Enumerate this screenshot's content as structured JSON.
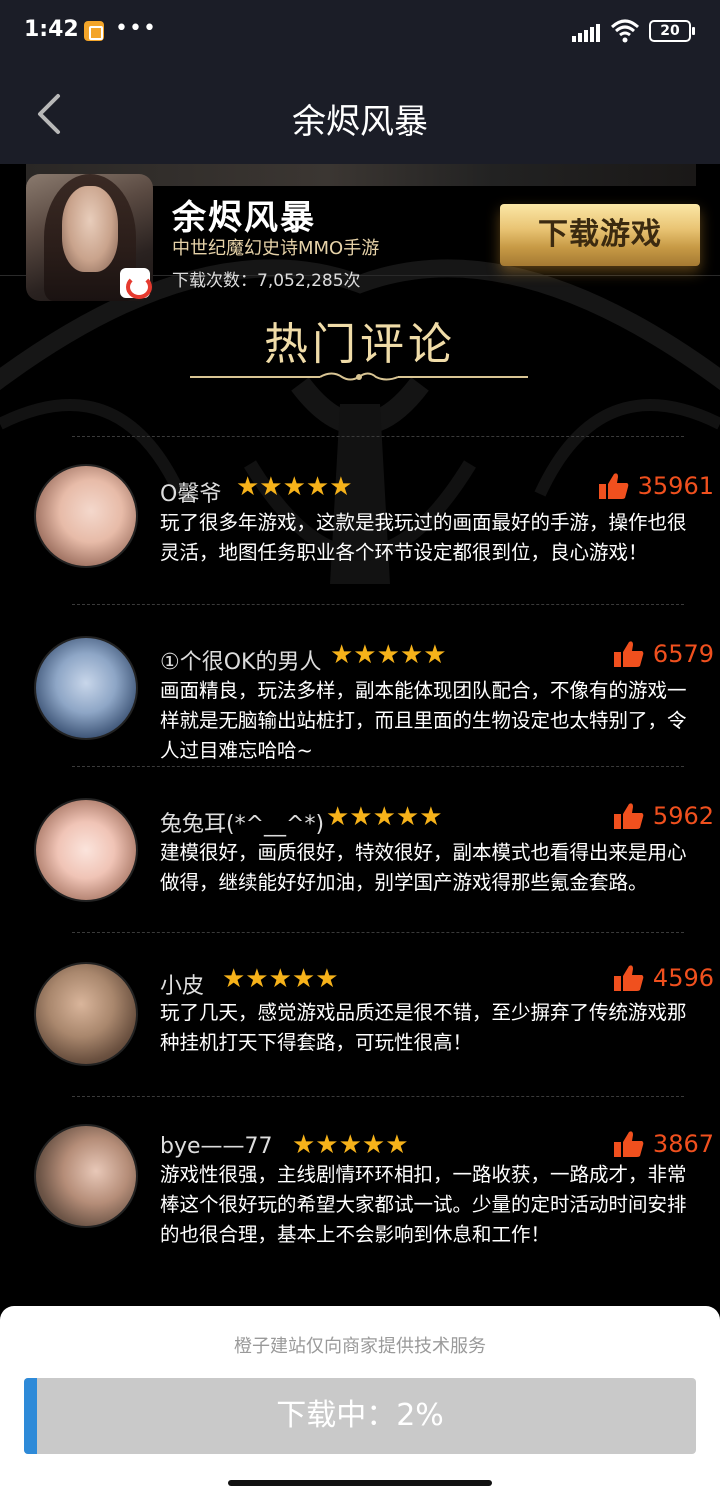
{
  "status_bar": {
    "time": "1:42",
    "dots": "•••",
    "battery": "20"
  },
  "nav": {
    "title": "余烬风暴"
  },
  "game": {
    "name": "余烬风暴",
    "subtitle": "中世纪魔幻史诗MMO手游",
    "downloads": "下载次数：7,052,285次",
    "download_button": "下载游戏"
  },
  "section": {
    "title": "热门评论"
  },
  "comments": [
    {
      "username": "O馨爷",
      "rating": 5,
      "stars": "★★★★★",
      "likes": "35961",
      "text": "玩了很多年游戏，这款是我玩过的画面最好的手游，操作也很灵活，地图任务职业各个环节设定都很到位，良心游戏！"
    },
    {
      "username": "①个很OK的男人",
      "rating": 5,
      "stars": "★★★★★",
      "likes": "6579",
      "text": "画面精良，玩法多样，副本能体现团队配合，不像有的游戏一样就是无脑输出站桩打，而且里面的生物设定也太特别了，令人过目难忘哈哈~"
    },
    {
      "username": "兔兔耳(*^__^*)",
      "rating": 5,
      "stars": "★★★★★",
      "likes": "5962",
      "text": "建模很好，画质很好，特效很好，副本模式也看得出来是用心做得，继续能好好加油，别学国产游戏得那些氪金套路。"
    },
    {
      "username": "小皮",
      "rating": 5,
      "stars": "★★★★★",
      "likes": "4596",
      "text": "玩了几天，感觉游戏品质还是很不错，至少摒弃了传统游戏那种挂机打天下得套路，可玩性很高！"
    },
    {
      "username": "bye——77",
      "rating": 5,
      "stars": "★★★★★",
      "likes": "3867",
      "text": "游戏性很强，主线剧情环环相扣，一路收获，一路成才，非常棒这个很好玩的希望大家都试一试。少量的定时活动时间安排的也很合理，基本上不会影响到休息和工作！"
    }
  ],
  "bottom": {
    "provider_text": "橙子建站仅向商家提供技术服务",
    "progress_label": "下载中：2%",
    "progress_percent": 2
  },
  "colors": {
    "accent_gold": "#f0dca8",
    "star": "#f6b21a",
    "like": "#f0501e",
    "progress_fill": "#2e8ad8"
  }
}
